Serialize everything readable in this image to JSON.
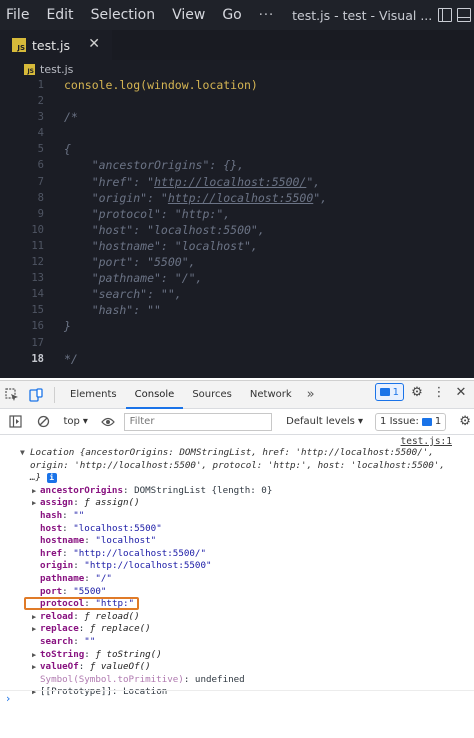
{
  "editor": {
    "menu": [
      "File",
      "Edit",
      "Selection",
      "View",
      "Go"
    ],
    "menu_more": "···",
    "window_title": "test.js - test - Visual ...",
    "tab": {
      "label": "test.js",
      "close": "✕",
      "badge": "JS"
    },
    "breadcrumb": "test.js",
    "active_line": 18,
    "lines": [
      {
        "n": "1",
        "text": "console.log(window.location)",
        "style": "code"
      },
      {
        "n": "2",
        "text": "",
        "style": "code"
      },
      {
        "n": "3",
        "text": "/*",
        "style": "comment"
      },
      {
        "n": "4",
        "text": "",
        "style": "comment"
      },
      {
        "n": "5",
        "text": "{",
        "style": "comment"
      },
      {
        "n": "6",
        "text": "    \"ancestorOrigins\": {},",
        "style": "comment"
      },
      {
        "n": "7",
        "text": "    \"href\": \"http://localhost:5500/\",",
        "style": "comment",
        "url": "http://localhost:5500/"
      },
      {
        "n": "8",
        "text": "    \"origin\": \"http://localhost:5500\",",
        "style": "comment",
        "url": "http://localhost:5500"
      },
      {
        "n": "9",
        "text": "    \"protocol\": \"http:\",",
        "style": "comment"
      },
      {
        "n": "10",
        "text": "    \"host\": \"localhost:5500\",",
        "style": "comment"
      },
      {
        "n": "11",
        "text": "    \"hostname\": \"localhost\",",
        "style": "comment"
      },
      {
        "n": "12",
        "text": "    \"port\": \"5500\",",
        "style": "comment"
      },
      {
        "n": "13",
        "text": "    \"pathname\": \"/\",",
        "style": "comment"
      },
      {
        "n": "14",
        "text": "    \"search\": \"\",",
        "style": "comment"
      },
      {
        "n": "15",
        "text": "    \"hash\": \"\"",
        "style": "comment"
      },
      {
        "n": "16",
        "text": "}",
        "style": "comment"
      },
      {
        "n": "17",
        "text": "",
        "style": "comment"
      },
      {
        "n": "18",
        "text": "*/",
        "style": "comment"
      }
    ]
  },
  "devtools": {
    "tabs": [
      "Elements",
      "Console",
      "Sources",
      "Network"
    ],
    "active_tab": "Console",
    "tabs_more": "»",
    "message_count": "1",
    "context": "top",
    "filter_placeholder": "Filter",
    "levels": "Default levels ▾",
    "issues": "1 Issue:",
    "issues_count": "1",
    "source_link": "test.js:1",
    "object_summary": "Location {ancestorOrigins: DOMStringList, href: 'http://localhost:5500/', origin: 'http://localhost:5500', protocol: 'http:', host: 'localhost:5500', …}",
    "info_badge": "i",
    "props": [
      {
        "key": "ancestorOrigins",
        "value": "DOMStringList {length: 0}",
        "expandable": true,
        "kind": "plain"
      },
      {
        "key": "assign",
        "value": "ƒ assign()",
        "expandable": true,
        "kind": "fn"
      },
      {
        "key": "hash",
        "value": "\"\"",
        "expandable": false,
        "kind": "str"
      },
      {
        "key": "host",
        "value": "\"localhost:5500\"",
        "expandable": false,
        "kind": "str"
      },
      {
        "key": "hostname",
        "value": "\"localhost\"",
        "expandable": false,
        "kind": "str"
      },
      {
        "key": "href",
        "value": "\"http://localhost:5500/\"",
        "expandable": false,
        "kind": "str"
      },
      {
        "key": "origin",
        "value": "\"http://localhost:5500\"",
        "expandable": false,
        "kind": "str"
      },
      {
        "key": "pathname",
        "value": "\"/\"",
        "expandable": false,
        "kind": "str"
      },
      {
        "key": "port",
        "value": "\"5500\"",
        "expandable": false,
        "kind": "str"
      },
      {
        "key": "protocol",
        "value": "\"http:\"",
        "expandable": false,
        "kind": "str"
      },
      {
        "key": "reload",
        "value": "ƒ reload()",
        "expandable": true,
        "kind": "fn",
        "highlighted": true
      },
      {
        "key": "replace",
        "value": "ƒ replace()",
        "expandable": true,
        "kind": "fn"
      },
      {
        "key": "search",
        "value": "\"\"",
        "expandable": false,
        "kind": "str"
      },
      {
        "key": "toString",
        "value": "ƒ toString()",
        "expandable": true,
        "kind": "fn"
      },
      {
        "key": "valueOf",
        "value": "ƒ valueOf()",
        "expandable": true,
        "kind": "fn"
      },
      {
        "key": "Symbol(Symbol.toPrimitive)",
        "value": "undefined",
        "expandable": false,
        "kind": "plain",
        "dim": true
      },
      {
        "key": "[[Prototype]]",
        "value": "Location",
        "expandable": true,
        "kind": "plain",
        "proto": true
      }
    ],
    "prompt": "›",
    "highlight_color": "#e07b28"
  }
}
